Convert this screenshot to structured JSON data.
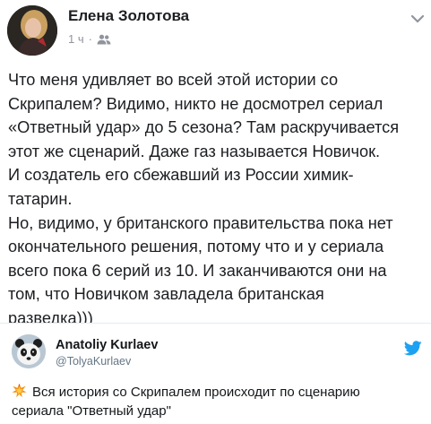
{
  "facebook_post": {
    "author_name": "Елена Золотова",
    "timestamp": "1 ч",
    "separator": "·",
    "audience_icon": "friends-icon",
    "menu_icon": "chevron-down-icon",
    "body_lines": [
      "Что меня удивляет во всей этой истории со",
      "Скрипалем? Видимо, никто не досмотрел сериал",
      "«Ответный удар» до 5 сезона? Там раскручивается",
      "этот же сценарий. Даже газ называется Новичок.",
      "И создатель его сбежавший из России химик-",
      "татарин.",
      "Но, видимо, у британского правительства пока нет",
      "окончательного решения, потому что и у сериала",
      "всего пока 6 серий из 10. И заканчиваются они на",
      "том, что Новичком завладела британская",
      "разведка)))"
    ]
  },
  "twitter_post": {
    "author_name": "Anatoliy Kurlaev",
    "handle": "@TolyaKurlaev",
    "logo_icon": "twitter-bird-icon",
    "emoji_icon": "collision-emoji-icon",
    "body_lines": [
      "Вся история со Скрипалем происходит по сценарию",
      "сериала \"Ответный удар\""
    ]
  },
  "colors": {
    "facebook_text": "#1c1e21",
    "facebook_meta": "#90949c",
    "twitter_text": "#14171a",
    "twitter_handle": "#657786",
    "twitter_blue": "#1da1f2",
    "divider": "#e6ecf0"
  }
}
